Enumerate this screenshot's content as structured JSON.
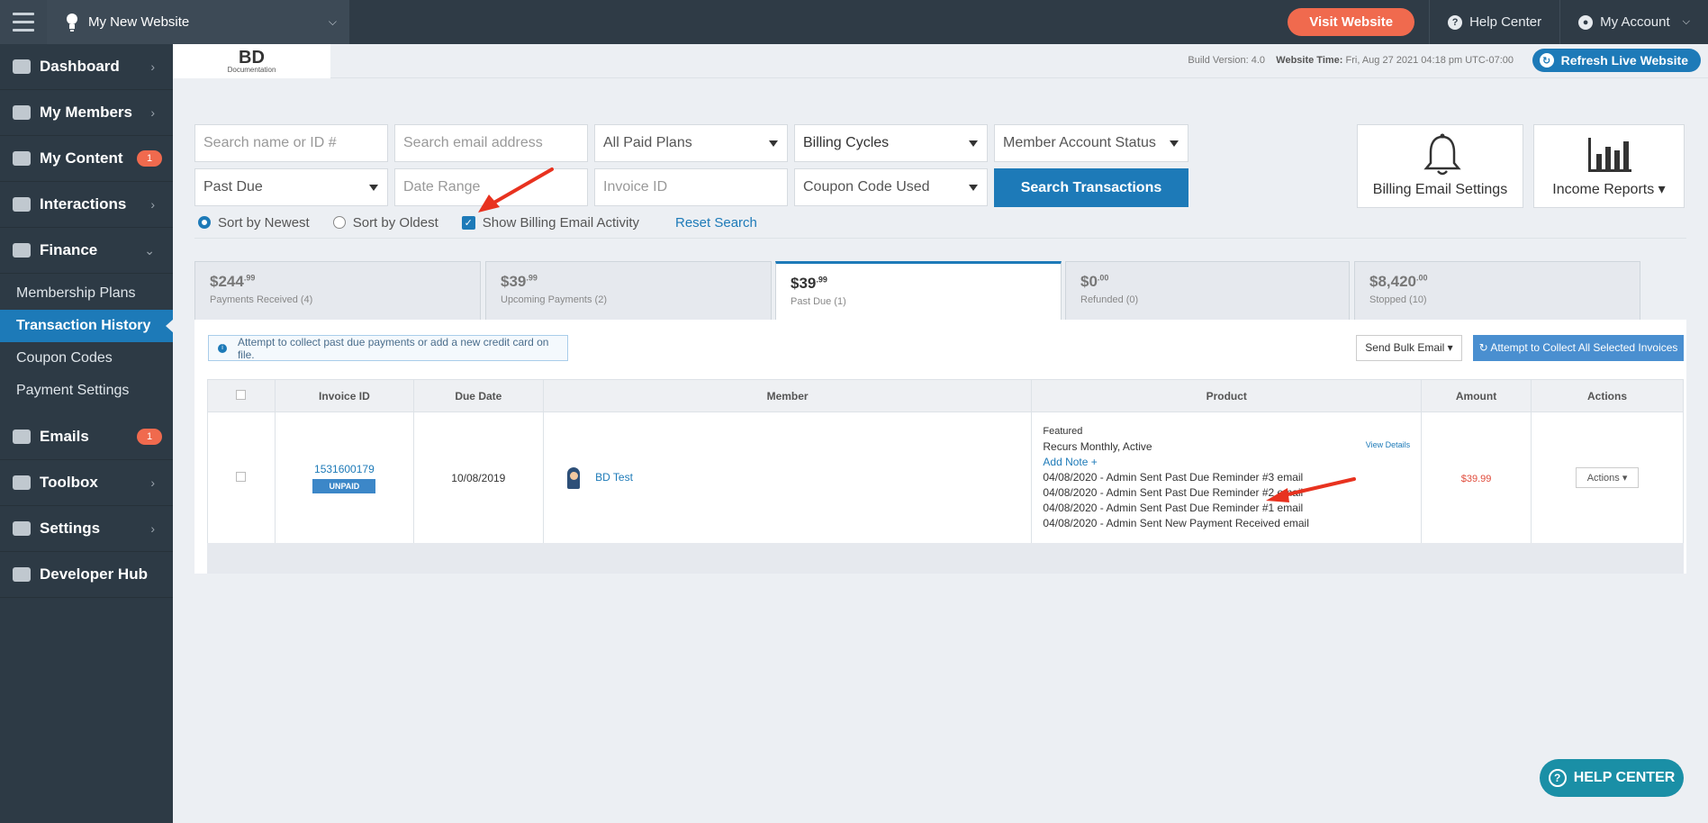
{
  "topbar": {
    "site_name": "My New Website",
    "visit_label": "Visit Website",
    "help_label": "Help Center",
    "account_label": "My Account"
  },
  "sidebar": {
    "items": [
      {
        "label": "Dashboard",
        "icon": "home-icon"
      },
      {
        "label": "My Members",
        "icon": "users-icon"
      },
      {
        "label": "My Content",
        "icon": "folder-icon",
        "badge": "1"
      },
      {
        "label": "Interactions",
        "icon": "comments-icon"
      },
      {
        "label": "Finance",
        "icon": "pie-chart-icon"
      },
      {
        "label": "Emails",
        "icon": "inbox-icon",
        "badge": "1"
      },
      {
        "label": "Toolbox",
        "icon": "wrench-icon"
      },
      {
        "label": "Settings",
        "icon": "gear-icon"
      },
      {
        "label": "Developer Hub",
        "icon": "grid-icon"
      }
    ],
    "finance_sub": [
      "Membership Plans",
      "Transaction History",
      "Coupon Codes",
      "Payment Settings"
    ]
  },
  "header": {
    "logo_main": "BD",
    "logo_sub": "Documentation",
    "build_label": "Build Version:",
    "build_value": "4.0",
    "time_label": "Website Time:",
    "time_value": "Fri, Aug 27 2021 04:18 pm UTC-07:00",
    "refresh_label": "Refresh Live Website"
  },
  "filters": {
    "name_placeholder": "Search name or ID #",
    "email_placeholder": "Search email address",
    "plans": "All Paid Plans",
    "billing_cycles": "Billing Cycles",
    "account_status": "Member Account Status",
    "status": "Past Due",
    "date_placeholder": "Date Range",
    "invoice_placeholder": "Invoice ID",
    "coupon": "Coupon Code Used",
    "search_button": "Search Transactions",
    "sort_newest": "Sort by Newest",
    "sort_oldest": "Sort by Oldest",
    "show_email_activity": "Show Billing Email Activity",
    "reset": "Reset Search",
    "billing_email_settings": "Billing Email Settings",
    "income_reports": "Income Reports"
  },
  "summary_tabs": [
    {
      "amount": "$244",
      "cents": ".99",
      "label": "Payments Received (4)"
    },
    {
      "amount": "$39",
      "cents": ".99",
      "label": "Upcoming Payments (2)"
    },
    {
      "amount": "$39",
      "cents": ".99",
      "label": "Past Due (1)"
    },
    {
      "amount": "$0",
      "cents": ".00",
      "label": "Refunded (0)"
    },
    {
      "amount": "$8,420",
      "cents": ".00",
      "label": "Stopped (10)"
    }
  ],
  "panel": {
    "info": "Attempt to collect past due payments or add a new credit card on file.",
    "bulk_email": "Send Bulk Email",
    "collect_all": "Attempt to Collect All Selected Invoices"
  },
  "table": {
    "headers": [
      "Invoice ID",
      "Due Date",
      "Member",
      "Product",
      "Amount",
      "Actions"
    ],
    "row": {
      "invoice_id": "1531600179",
      "status": "UNPAID",
      "due_date": "10/08/2019",
      "member": "BD Test",
      "product_name": "Featured",
      "recurs": "Recurs Monthly, Active",
      "view_details": "View Details",
      "add_note": "Add Note +",
      "activity": [
        "04/08/2020 - Admin Sent Past Due Reminder #3 email",
        "04/08/2020 - Admin Sent Past Due Reminder #2 email",
        "04/08/2020 - Admin Sent Past Due Reminder #1 email",
        "04/08/2020 - Admin Sent New Payment Received email"
      ],
      "amount": "$39.99",
      "actions": "Actions"
    }
  },
  "help_float": "HELP CENTER",
  "colors": {
    "accent": "#1d7ab8",
    "orange": "#f06a4e",
    "annotation": "#e8321f"
  }
}
